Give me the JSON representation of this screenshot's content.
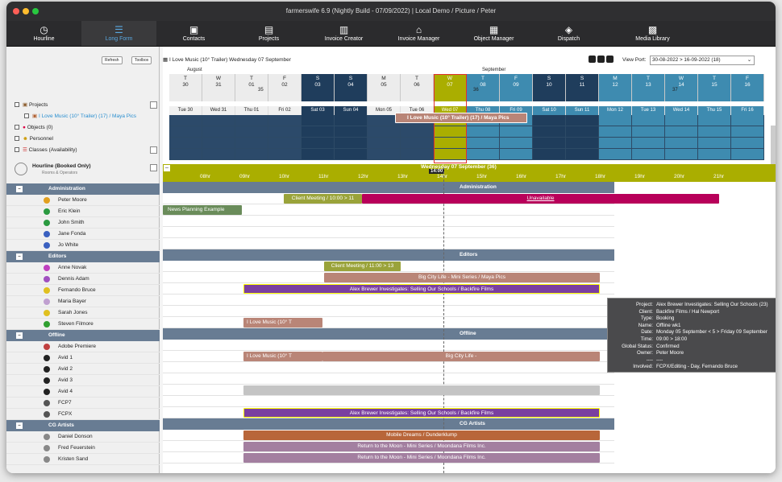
{
  "app": {
    "title": "farmerswife 6.9  (Nightly Build - 07/09/2022) | Local Demo / Picture / Peter"
  },
  "toolbar": [
    {
      "label": "Hourline",
      "icon": "clock-icon"
    },
    {
      "label": "Long Form",
      "icon": "longform-icon"
    },
    {
      "label": "Contacts",
      "icon": "contacts-icon"
    },
    {
      "label": "Projects",
      "icon": "briefcase-icon"
    },
    {
      "label": "Invoice Creator",
      "icon": "document-icon"
    },
    {
      "label": "Invoice Manager",
      "icon": "bank-icon"
    },
    {
      "label": "Object Manager",
      "icon": "objects-icon"
    },
    {
      "label": "Dispatch",
      "icon": "dispatch-icon"
    },
    {
      "label": "Media Library",
      "icon": "media-icon"
    }
  ],
  "left": {
    "refresh": "Refresh",
    "toolbox": "Toolbox",
    "tree": [
      "Projects",
      "I Love Music (10° Trailer) (17) / Maya Pics",
      "Objects (0)",
      "Personnel",
      "Classes (Availability)"
    ],
    "hourline_title": "Hourline (Booked Only)",
    "hourline_sub": "Rooms & Operators"
  },
  "header": {
    "project": "I Love Music (10° Trailer)  Wednesday 07 September",
    "viewport_label": "View Port:",
    "viewport_value": "30-08-2022 > 16-09-2022 (18)",
    "month_aug": "August",
    "month_sep": "September",
    "week35": "35",
    "week36": "36",
    "week37": "37"
  },
  "days": [
    {
      "d": "T",
      "n": "30",
      "l": "Tue 30"
    },
    {
      "d": "W",
      "n": "31",
      "l": "Wed 31"
    },
    {
      "d": "T",
      "n": "01",
      "l": "Thu 01"
    },
    {
      "d": "F",
      "n": "02",
      "l": "Fri 02"
    },
    {
      "d": "S",
      "n": "03",
      "l": "Sat 03"
    },
    {
      "d": "S",
      "n": "04",
      "l": "Sun 04"
    },
    {
      "d": "M",
      "n": "05",
      "l": "Mon 05"
    },
    {
      "d": "T",
      "n": "06",
      "l": "Tue 06"
    },
    {
      "d": "W",
      "n": "07",
      "l": "Wed 07"
    },
    {
      "d": "T",
      "n": "08",
      "l": "Thu 08"
    },
    {
      "d": "F",
      "n": "09",
      "l": "Fri 09"
    },
    {
      "d": "S",
      "n": "10",
      "l": "Sat 10"
    },
    {
      "d": "S",
      "n": "11",
      "l": "Sun 11"
    },
    {
      "d": "M",
      "n": "12",
      "l": "Mon 12"
    },
    {
      "d": "T",
      "n": "13",
      "l": "Tue 13"
    },
    {
      "d": "W",
      "n": "14",
      "l": "Wed 14"
    },
    {
      "d": "T",
      "n": "15",
      "l": "Thu 15"
    },
    {
      "d": "F",
      "n": "16",
      "l": "Fri 16"
    }
  ],
  "booking_banner": "I Love Music (10° Trailer) (17) / Maya Pics",
  "hourline": {
    "date": "Wednesday 07 September (36)",
    "now": "14:00",
    "hours": [
      "08hr",
      "09hr",
      "10hr",
      "11hr",
      "12hr",
      "13hr",
      "14hr",
      "15hr",
      "16hr",
      "17hr",
      "18hr",
      "19hr",
      "20hr",
      "21hr"
    ]
  },
  "groups": {
    "admin": "Administration",
    "editors": "Editors",
    "offline": "Offline",
    "cg": "CG Artists"
  },
  "people": {
    "admin": [
      "Peter Moore",
      "Eric Klein",
      "John Smith",
      "Jane Fonda",
      "Jo White"
    ],
    "editors": [
      "Anne Novak",
      "Dennis Adam",
      "Fernando Bruce",
      "Maria Bayer",
      "Sarah Jones",
      "Steven Filmore"
    ],
    "offline": [
      "Adobe Premiere",
      "Avid 1",
      "Avid 2",
      "Avid 3",
      "Avid 4",
      "FCP7",
      "FCPX"
    ],
    "cg": [
      "Daniel Donson",
      "Fred Feuerstein",
      "Kristen Sand"
    ]
  },
  "bars": {
    "client1": "Client Meeting / 10:00 > 11",
    "unavailable": "Unavailable",
    "news": "News Planning Example",
    "client2": "Client Meeting / 11:00 > 13",
    "bigcity": "Big City Life - Mini Series / Maya Pics",
    "alex": "Alex Brewer Investigates: Selling Our Schools / Backfire Films",
    "ilove": "I Love Music (10° T",
    "bigcity2": "Big City Life -",
    "mobile": "Mobile Dreams / Dunderklump",
    "moon": "Return to the Moon - Mini Series / Moondana Films Inc."
  },
  "tooltip": [
    {
      "k": "Project:",
      "v": "Alex Brewer Investigates: Selling Our Schools (23)"
    },
    {
      "k": "Client:",
      "v": "Backfire Films / Hal Newport"
    },
    {
      "k": "Type:",
      "v": "Booking"
    },
    {
      "k": "Name:",
      "v": "Offline wk1"
    },
    {
      "k": "Date:",
      "v": "Monday 05 September < 5 > Friday 09 September"
    },
    {
      "k": "Time:",
      "v": "09:00 > 18:00"
    },
    {
      "k": "Global Status:",
      "v": "Confirmed"
    },
    {
      "k": "Owner:",
      "v": "Peter Moore"
    },
    {
      "k": "----",
      "v": "----"
    },
    {
      "k": "Involved:",
      "v": "FCPX/Editing - Day, Fernando Bruce"
    }
  ],
  "colors": {
    "accent": "#5aa8e0",
    "group": "#687c93",
    "today": "#aaae00",
    "weekend": "#1f3d5c",
    "future": "#3e8bb0"
  }
}
